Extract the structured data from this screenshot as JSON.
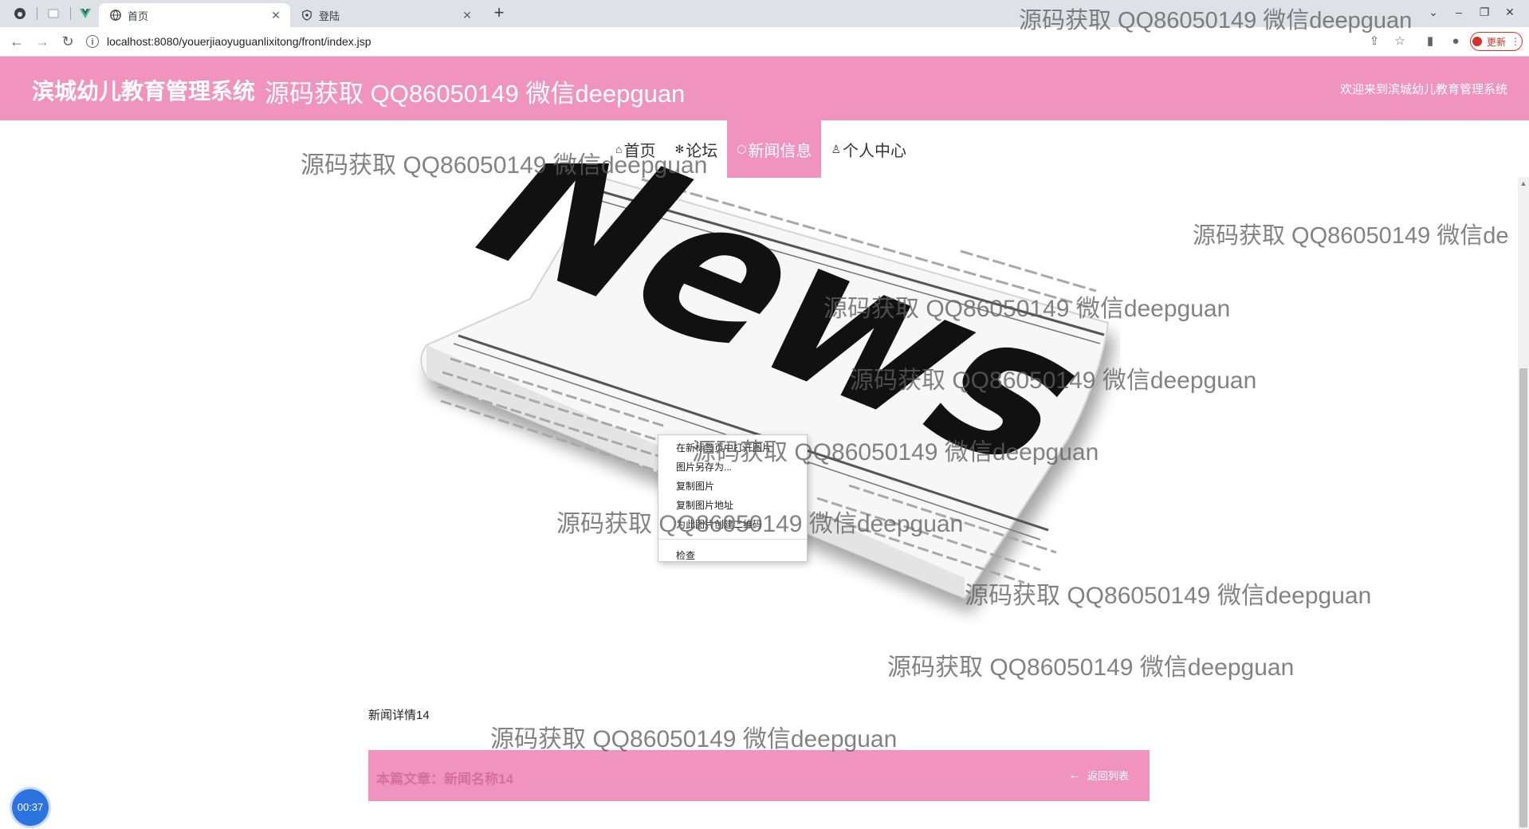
{
  "browser": {
    "tabs": [
      {
        "title": "首页",
        "active": true
      },
      {
        "title": "登陆",
        "active": false
      }
    ],
    "url": "localhost:8080/youerjiaoyuguanlixitong/front/index.jsp",
    "update_label": "更新"
  },
  "site": {
    "title": "滨城幼儿教育管理系统",
    "welcome": "欢迎来到滨城幼儿教育管理系统"
  },
  "nav": {
    "items": [
      {
        "label": "首页",
        "icon": "home-icon"
      },
      {
        "label": "论坛",
        "icon": "forum-icon"
      },
      {
        "label": "新闻信息",
        "icon": "news-icon"
      },
      {
        "label": "个人中心",
        "icon": "user-icon"
      }
    ],
    "active": "新闻信息"
  },
  "image": {
    "headline": "News"
  },
  "context_menu": {
    "items": [
      "在新标签页中打开图片",
      "图片另存为...",
      "复制图片",
      "复制图片地址",
      "为此图片创建二维码",
      "检查"
    ]
  },
  "article": {
    "label": "新闻详情14",
    "name": "本篇文章：新闻名称14",
    "back": "返回列表"
  },
  "timer": "00:37",
  "watermark": "源码获取 QQ86050149 微信deepguan",
  "colors": {
    "brand_pink": "#f094bf",
    "timer_blue": "#2a73e0"
  }
}
